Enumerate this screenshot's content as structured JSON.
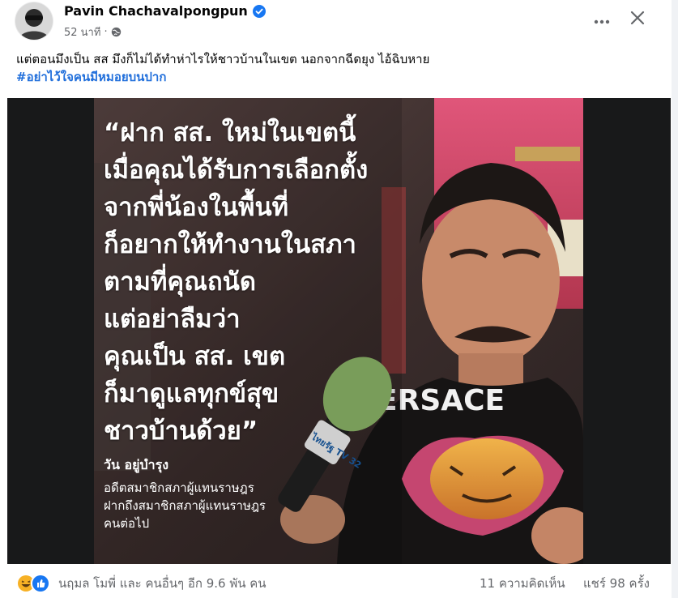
{
  "post": {
    "author": "Pavin Chachavalpongpun",
    "time": "52 นาที",
    "separator": "·",
    "caption_text": "แต่ตอนมึงเป็น สส มึงก็ไม่ได้ทำห่าไรให้ชาวบ้านในเขต นอกจากฉีดยุง ไอ้ฉิบหาย",
    "hashtag": "#อย่าไว้ใจคนมีหมอยบนปาก"
  },
  "image": {
    "quote": "“ฝาก สส. ใหม่ในเขตนี้\nเมื่อคุณได้รับการเลือกตั้ง\nจากพี่น้องในพื้นที่\nก็อยากให้ทำงานในสภา\nตามที่คุณถนัด\nแต่อย่าลืมว่า\nคุณเป็น สส. เขต\nก็มาดูแลทุกข์สุข\nชาวบ้านด้วย”",
    "person_name": "วัน อยู่บำรุง",
    "person_desc": "อดีตสมาชิกสภาผู้แทนราษฎร\nฝากถึงสมาชิกสภาผู้แทนราษฎร\nคนต่อไป",
    "shirt_brand": "ERSACE",
    "mic_label": "ไทยรัฐ TV 32"
  },
  "footer": {
    "reactors": "นฤมล โมพี่ และ คนอื่นๆ อีก 9.6 พัน คน",
    "comments": "11 ความคิดเห็น",
    "shares": "แชร์ 98 ครั้ง"
  },
  "icons": {
    "verified": "verified-badge-icon",
    "globe": "globe-icon",
    "more": "more-options-icon",
    "close": "close-icon",
    "reactions": [
      "haha-reaction-icon",
      "like-reaction-icon"
    ]
  },
  "colors": {
    "hashtag": "#216fdb",
    "verified": "#1877f2",
    "muted_text": "#65676b",
    "like_blue": "#1877f2",
    "haha_yellow": "#f7b125"
  }
}
